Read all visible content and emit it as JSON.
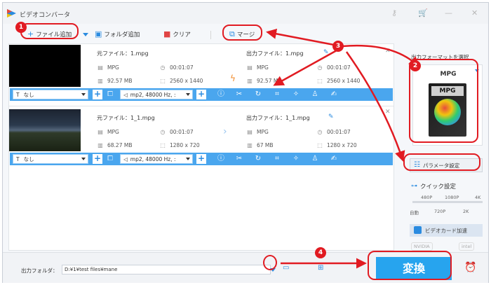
{
  "window": {
    "title": "ビデオコンバータ",
    "icons": [
      "key-icon",
      "cart-icon",
      "minimize-icon",
      "close-icon"
    ],
    "accent": "#2a8be0",
    "annotation_color": "#e11b22"
  },
  "toolbar": {
    "add_file": "ファイル追加",
    "add_folder": "フォルダ追加",
    "clear": "クリア",
    "merge": "マージ"
  },
  "files": [
    {
      "source_name": "元ファイル：1.mpg",
      "source_format": "MPG",
      "source_duration": "00:01:07",
      "source_size": "92.57 MB",
      "source_resolution": "2560 x 1440",
      "output_name": "出力ファイル：1.mpg",
      "output_format": "MPG",
      "output_duration": "00:01:07",
      "output_size": "92.57 MB",
      "output_resolution": "2560 x 1440",
      "subtitle": "なし",
      "audio": "mp2, 48000 Hz, :"
    },
    {
      "source_name": "元ファイル：1_1.mpg",
      "source_format": "MPG",
      "source_duration": "00:01:07",
      "source_size": "68.27 MB",
      "source_resolution": "1280 x 720",
      "output_name": "出力ファイル：1_1.mpg",
      "output_format": "MPG",
      "output_duration": "00:01:07",
      "output_size": "67 MB",
      "output_resolution": "1280 x 720",
      "subtitle": "なし",
      "audio": "mp2, 48000 Hz, :"
    }
  ],
  "right_panel": {
    "format_label": "出力フォーマットを選択",
    "format": "MPG",
    "format_icon_text": "MPG",
    "param_button": "パラメータ設定",
    "quick_label": "クイック設定",
    "slider_top": [
      "480P",
      "1080P",
      "4K"
    ],
    "slider_bottom": [
      "自動",
      "720P",
      "2K"
    ],
    "gpu_button": "ビデオカード加速",
    "vendors": [
      "NVIDIA",
      "intel"
    ]
  },
  "bottom": {
    "output_folder_label": "出力フォルダ：",
    "output_path": "D:¥1¥test files¥mane",
    "convert_button": "変換"
  },
  "annotations": [
    "1",
    "2",
    "3",
    "4"
  ]
}
